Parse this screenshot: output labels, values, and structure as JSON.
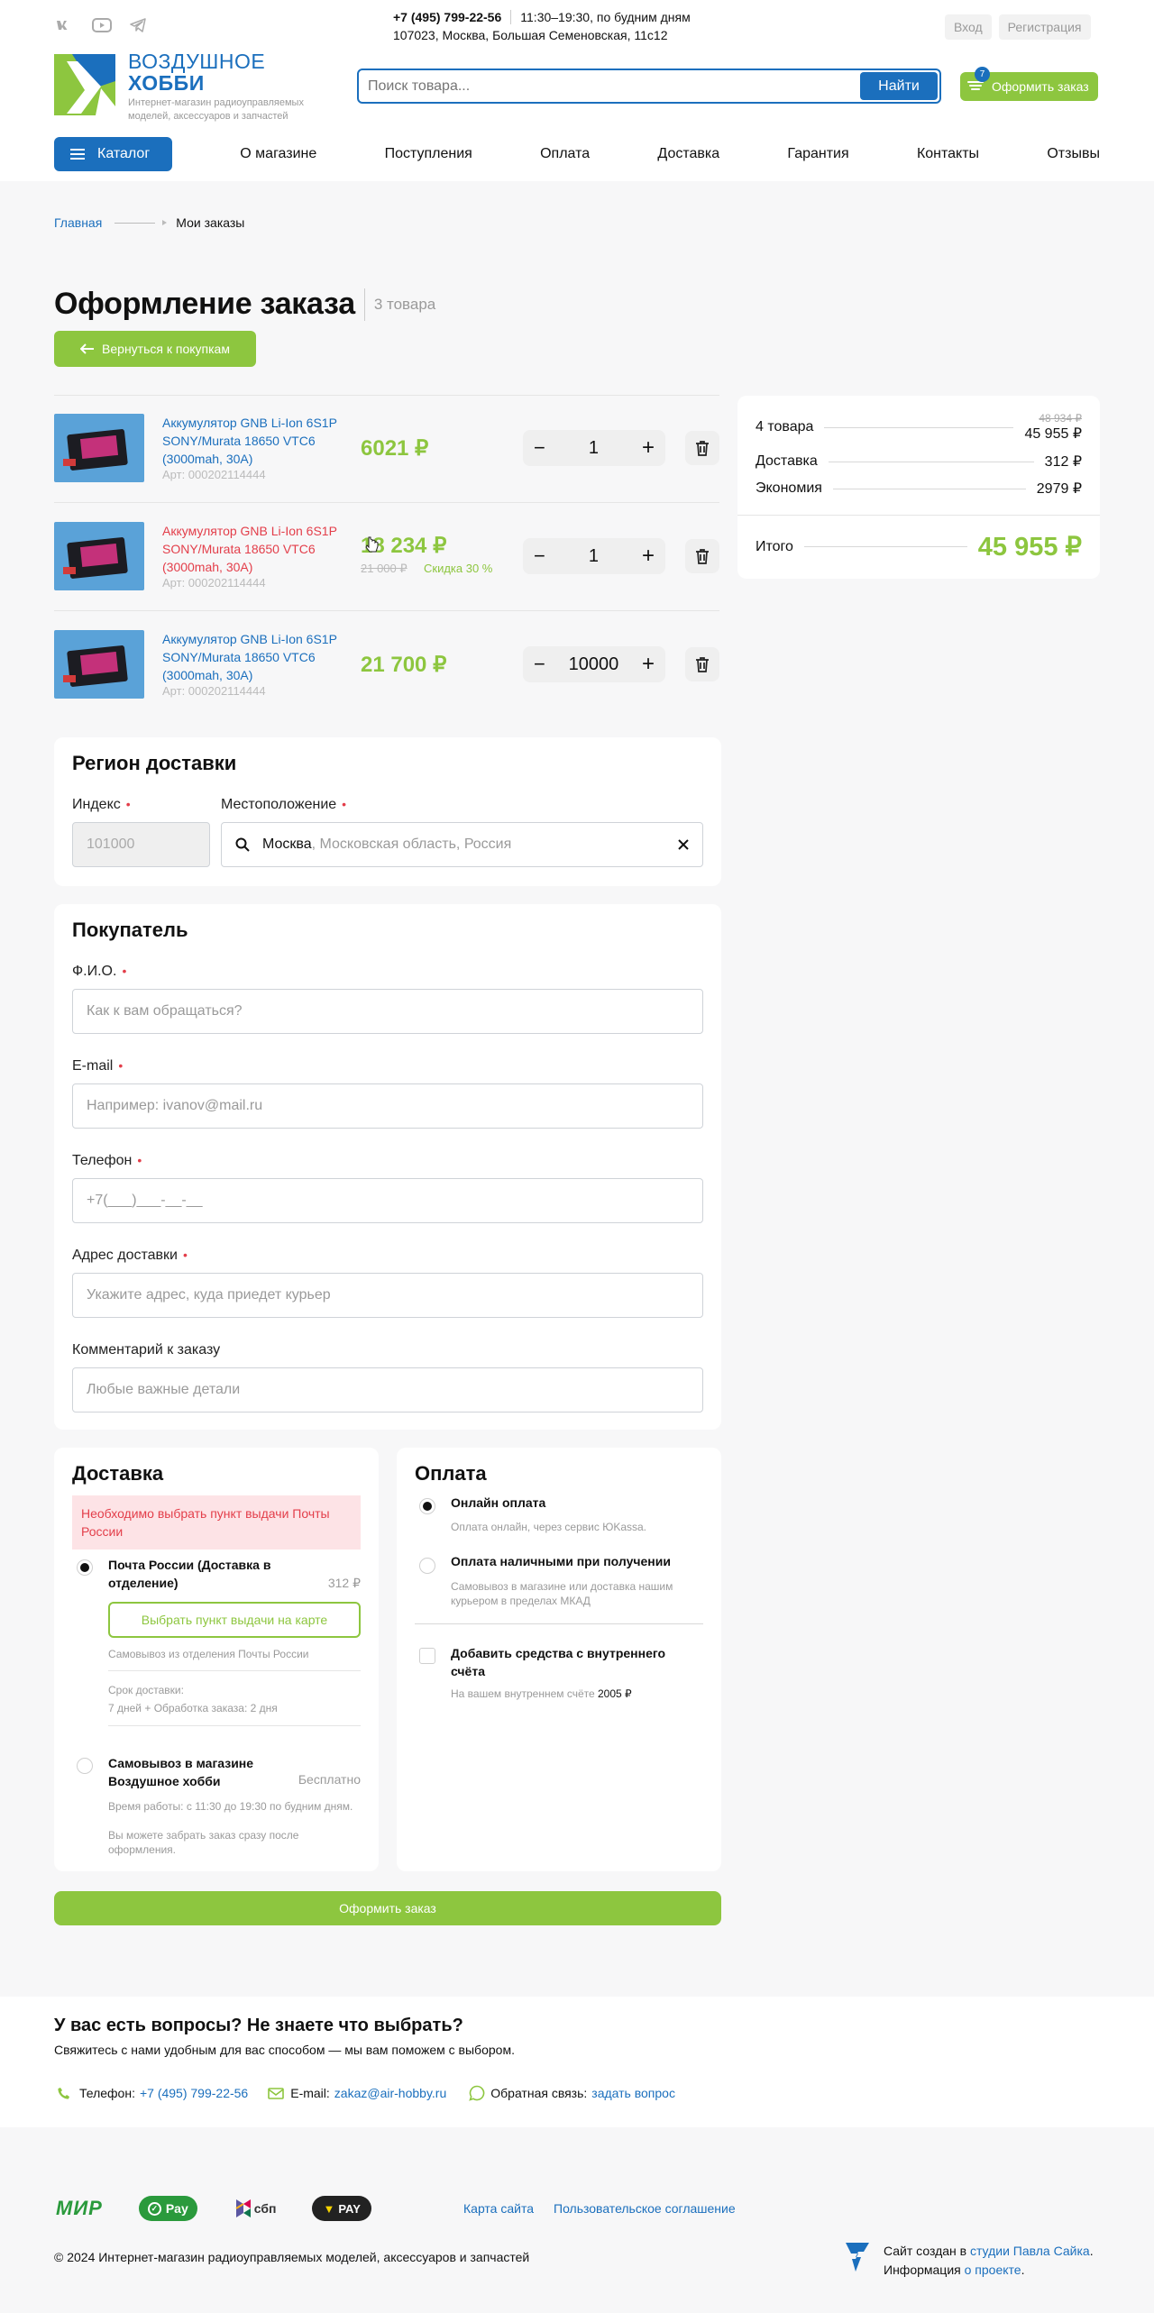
{
  "header": {
    "phone": "+7 (495) 799-22-56",
    "hours": "11:30–19:30, по будним дням",
    "address": "107023, Москва, Большая Семеновская, 11с12",
    "login": "Вход",
    "register": "Регистрация",
    "logo_line1": "ВОЗДУШНОЕ",
    "logo_line2": "ХОББИ",
    "logo_tagline": "Интернет-магазин радиоуправляемых моделей, аксессуаров и запчастей",
    "search_placeholder": "Поиск товара...",
    "search_button": "Найти",
    "checkout_button": "Оформить заказ",
    "cart_count": "7"
  },
  "nav": {
    "catalog": "Каталог",
    "items": [
      "О магазине",
      "Поступления",
      "Оплата",
      "Доставка",
      "Гарантия",
      "Контакты",
      "Отзывы"
    ]
  },
  "breadcrumb": {
    "home": "Главная",
    "current": "Мои заказы"
  },
  "page": {
    "title": "Оформление заказа",
    "count": "3 товара",
    "back_button": "Вернуться к покупкам"
  },
  "products": [
    {
      "name": "Аккумулятор GNB Li-Ion 6S1P SONY/Murata 18650 VTC6 (3000mah, 30A)",
      "sku": "Арт: 000202114444",
      "price": "6021 ₽",
      "old_price": "",
      "discount": "",
      "qty": "1",
      "highlight": false
    },
    {
      "name": "Аккумулятор GNB Li-Ion 6S1P SONY/Murata 18650 VTC6 (3000mah, 30A)",
      "sku": "Арт: 000202114444",
      "price": "18 234 ₽",
      "old_price": "21 000 ₽",
      "discount": "Скидка 30 %",
      "qty": "1",
      "highlight": true
    },
    {
      "name": "Аккумулятор GNB Li-Ion 6S1P SONY/Murata 18650 VTC6 (3000mah, 30A)",
      "sku": "Арт: 000202114444",
      "price": "21 700 ₽",
      "old_price": "",
      "discount": "",
      "qty": "10000",
      "highlight": false
    }
  ],
  "summary": {
    "items_label": "4 товара",
    "items_old": "48 934 ₽",
    "items_value": "45 955 ₽",
    "delivery_label": "Доставка",
    "delivery_value": "312 ₽",
    "economy_label": "Экономия",
    "economy_value": "2979 ₽",
    "total_label": "Итого",
    "total_value": "45 955 ₽"
  },
  "region": {
    "title": "Регион доставки",
    "index_label": "Индекс",
    "index_value": "101000",
    "location_label": "Местоположение",
    "location_city": "Москва",
    "location_rest": ", Московская область, Россия"
  },
  "buyer": {
    "title": "Покупатель",
    "fio_label": "Ф.И.О.",
    "fio_placeholder": "Как к вам обращаться?",
    "email_label": "E-mail",
    "email_placeholder": "Например: ivanov@mail.ru",
    "phone_label": "Телефон",
    "phone_placeholder": "+7(___)___-__-__",
    "address_label": "Адрес доставки",
    "address_placeholder": "Укажите адрес, куда приедет курьер",
    "comment_label": "Комментарий к заказу",
    "comment_placeholder": "Любые важные детали"
  },
  "delivery": {
    "title": "Доставка",
    "alert": "Необходимо выбрать пункт выдачи Почты России",
    "post_title": "Почта России (Доставка в отделение)",
    "post_price": "312 ₽",
    "post_button": "Выбрать пункт выдачи на карте",
    "post_note": "Самовывоз из отделения Почты России",
    "post_term_label": "Срок доставки:",
    "post_term_value": "7 дней + Обработка заказа: 2 дня",
    "pickup_title": "Самовывоз в магазине Воздушное хобби",
    "pickup_price": "Бесплатно",
    "pickup_note1": "Время работы: с 11:30 до 19:30 по будним дням.",
    "pickup_note2": "Вы можете забрать заказ сразу после оформления."
  },
  "payment": {
    "title": "Оплата",
    "online_title": "Онлайн оплата",
    "online_note": "Оплата онлайн, через сервис ЮKassa.",
    "cash_title": "Оплата наличными при получении",
    "cash_note": "Самовывоз в магазине или доставка нашим курьером в пределах МКАД",
    "balance_title": "Добавить средства с внутреннего счёта",
    "balance_note": "На вашем внутреннем счёте",
    "balance_value": "2005 ₽"
  },
  "submit_button": "Оформить заказ",
  "help": {
    "title": "У вас есть вопросы? Не знаете что выбрать?",
    "subtitle": "Свяжитесь с нами удобным для вас способом — мы вам поможем с выбором.",
    "phone_label": "Телефон:",
    "phone_value": "+7 (495) 799-22-56",
    "email_label": "E-mail:",
    "email_value": "zakaz@air-hobby.ru",
    "feedback_label": "Обратная связь:",
    "feedback_value": "задать вопрос"
  },
  "footer": {
    "pay_mir": "МИР",
    "pay_gpay": "Pay",
    "pay_sbp": "сбп",
    "pay_other": "PAY",
    "sitemap": "Карта сайта",
    "agreement": "Пользовательское соглашение",
    "copyright": "© 2024 Интернет-магазин радиоуправляемых моделей, аксессуаров и запчастей",
    "made_prefix": "Сайт создан в",
    "made_link": "студии Павла Сайка",
    "info_prefix": "Информация",
    "info_link": "о проекте"
  },
  "colors": {
    "brand_green": "#8dc63f",
    "brand_blue": "#1b6fbd",
    "price_red": "#e33e4a"
  }
}
